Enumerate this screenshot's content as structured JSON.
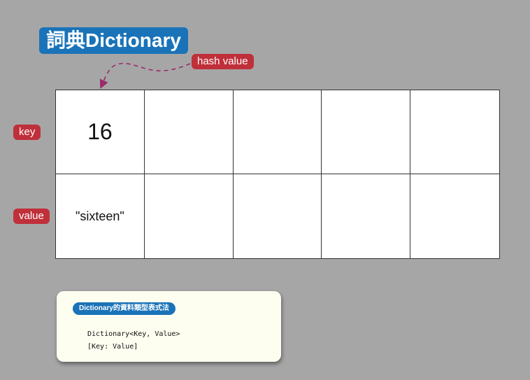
{
  "title": "詞典Dictionary",
  "labels": {
    "hash": "hash value",
    "key": "key",
    "value": "value"
  },
  "table": {
    "keys": [
      "16",
      "",
      "",
      "",
      ""
    ],
    "values": [
      "\"sixteen\"",
      "",
      "",
      "",
      ""
    ]
  },
  "info": {
    "badge": "Dictionary的資料類型表式法",
    "lines": [
      "Dictionary<Key, Value>",
      "[Key: Value]"
    ]
  },
  "colors": {
    "background": "#a6a6a6",
    "title_badge": "#1a73b8",
    "label_pill": "#c0303a",
    "arrow": "#9b2a6a",
    "card": "#fdfdf0"
  }
}
